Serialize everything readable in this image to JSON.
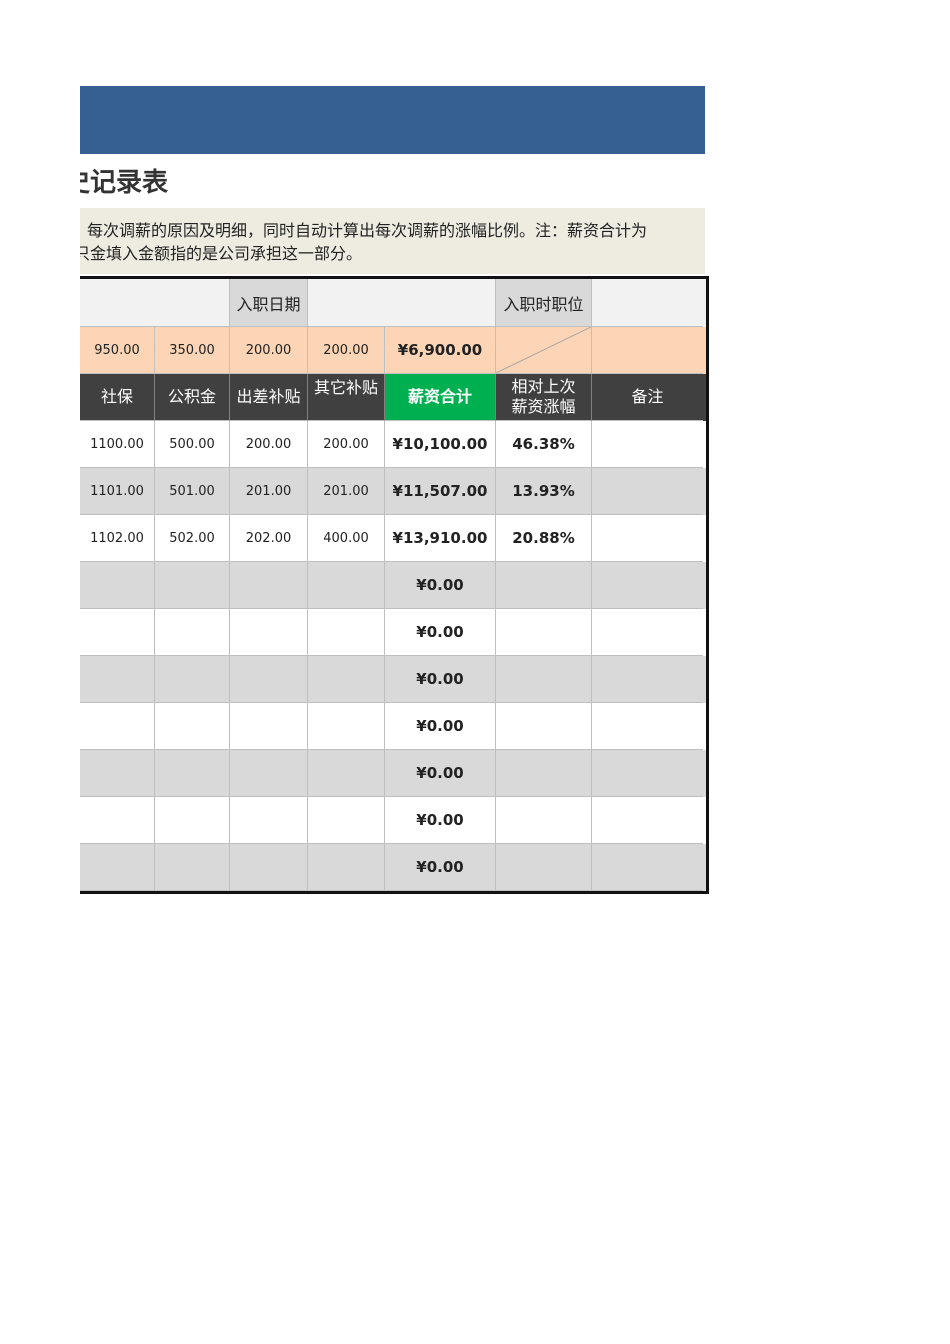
{
  "title": "史记录表",
  "note": {
    "line1": "每次调薪的原因及明细，同时自动计算出每次调薪的涨幅比例。注：薪资合计为",
    "line2": "只金填入金额指的是公司承担这一部分。"
  },
  "info_row": {
    "hire_date_label": "入职日期",
    "hire_date_value": "",
    "hire_position_label": "入职时职位",
    "hire_position_value": ""
  },
  "base_row": {
    "social_insurance": "950.00",
    "housing_fund": "350.00",
    "travel_allowance": "200.00",
    "other_allowance": "200.00",
    "total": "¥6,900.00"
  },
  "headers": [
    "社保",
    "公积金",
    "出差补贴",
    "其它补贴",
    "薪资合计",
    "相对上次薪资涨幅",
    "备注"
  ],
  "rows": [
    {
      "social": "1100.00",
      "fund": "500.00",
      "travel": "200.00",
      "other": "200.00",
      "total": "¥10,100.00",
      "pct": "46.38%",
      "remark": ""
    },
    {
      "social": "1101.00",
      "fund": "501.00",
      "travel": "201.00",
      "other": "201.00",
      "total": "¥11,507.00",
      "pct": "13.93%",
      "remark": ""
    },
    {
      "social": "1102.00",
      "fund": "502.00",
      "travel": "202.00",
      "other": "400.00",
      "total": "¥13,910.00",
      "pct": "20.88%",
      "remark": ""
    },
    {
      "social": "",
      "fund": "",
      "travel": "",
      "other": "",
      "total": "¥0.00",
      "pct": "",
      "remark": ""
    },
    {
      "social": "",
      "fund": "",
      "travel": "",
      "other": "",
      "total": "¥0.00",
      "pct": "",
      "remark": ""
    },
    {
      "social": "",
      "fund": "",
      "travel": "",
      "other": "",
      "total": "¥0.00",
      "pct": "",
      "remark": ""
    },
    {
      "social": "",
      "fund": "",
      "travel": "",
      "other": "",
      "total": "¥0.00",
      "pct": "",
      "remark": ""
    },
    {
      "social": "",
      "fund": "",
      "travel": "",
      "other": "",
      "total": "¥0.00",
      "pct": "",
      "remark": ""
    },
    {
      "social": "",
      "fund": "",
      "travel": "",
      "other": "",
      "total": "¥0.00",
      "pct": "",
      "remark": ""
    },
    {
      "social": "",
      "fund": "",
      "travel": "",
      "other": "",
      "total": "¥0.00",
      "pct": "",
      "remark": ""
    }
  ],
  "colors": {
    "banner": "#376092",
    "header_bg": "#404040",
    "total_header": "#00b050",
    "base_row": "#fbd5b5",
    "alt_row": "#d9d9d9",
    "note_bg": "#eeece1"
  }
}
